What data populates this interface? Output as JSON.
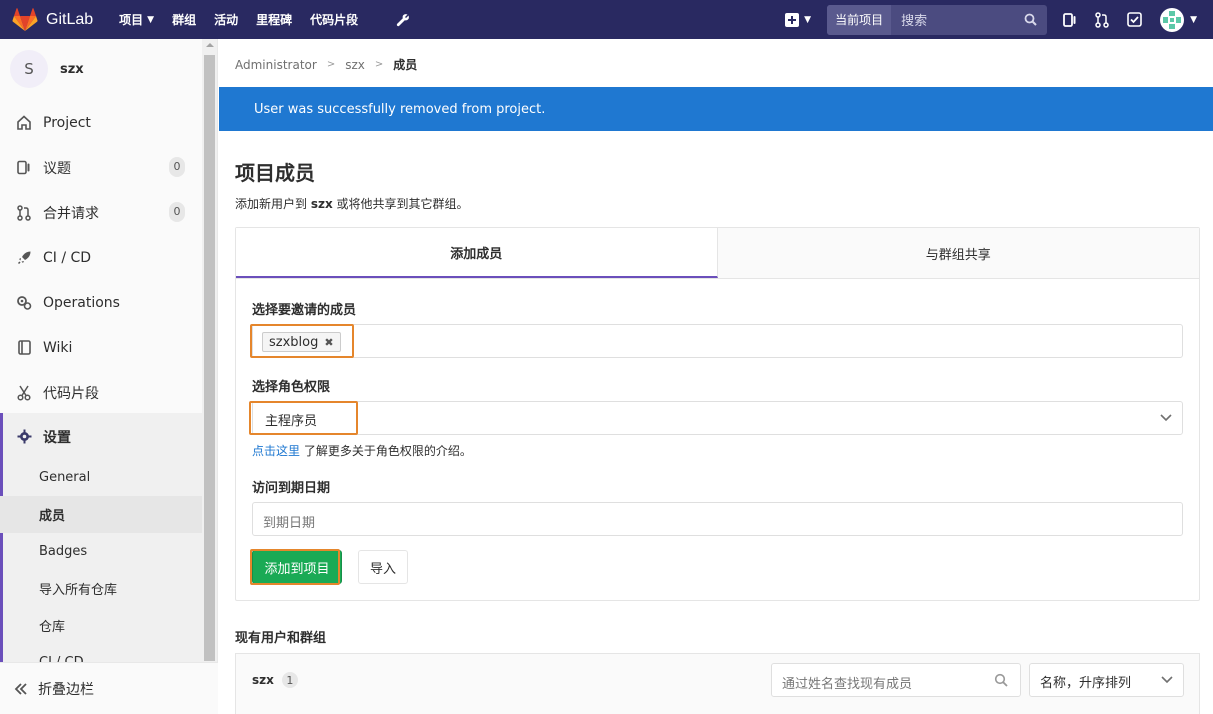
{
  "navbar": {
    "brand": "GitLab",
    "items": [
      "项目",
      "群组",
      "活动",
      "里程碑",
      "代码片段"
    ],
    "search_scope": "当前项目",
    "search_placeholder": "搜索",
    "bg_color": "#292961"
  },
  "sidebar": {
    "project_initial": "S",
    "project_name": "szx",
    "items": [
      {
        "label": "Project",
        "icon": "home-icon"
      },
      {
        "label": "议题",
        "icon": "issues-icon",
        "badge": "0"
      },
      {
        "label": "合并请求",
        "icon": "merge-request-icon",
        "badge": "0"
      },
      {
        "label": "CI / CD",
        "icon": "rocket-icon"
      },
      {
        "label": "Operations",
        "icon": "cloud-gear-icon"
      },
      {
        "label": "Wiki",
        "icon": "book-icon"
      },
      {
        "label": "代码片段",
        "icon": "scissors-icon"
      },
      {
        "label": "设置",
        "icon": "settings-gear-icon"
      }
    ],
    "settings_sub": [
      "General",
      "成员",
      "Badges",
      "导入所有仓库",
      "仓库",
      "CI / CD"
    ],
    "collapse_label": "折叠边栏"
  },
  "breadcrumb": [
    "Administrator",
    "szx",
    "成员"
  ],
  "flash": {
    "message": "User was successfully removed from project.",
    "color": "#1f78d1"
  },
  "page": {
    "title": "项目成员",
    "desc_prefix": "添加新用户到 ",
    "desc_project": "szx",
    "desc_suffix": " 或将他共享到其它群组。"
  },
  "tabs": [
    "添加成员",
    "与群组共享"
  ],
  "form": {
    "invite_label": "选择要邀请的成员",
    "invite_token": "szxblog",
    "role_label": "选择角色权限",
    "role_value": "主程序员",
    "help_link": "点击这里",
    "help_text": " 了解更多关于角色权限的介绍。",
    "expires_label": "访问到期日期",
    "expires_placeholder": "到期日期",
    "submit_label": "添加到项目",
    "import_label": "导入"
  },
  "members": {
    "section_title": "现有用户和群组",
    "group_name": "szx",
    "count": "1",
    "search_placeholder": "通过姓名查找现有成员",
    "sort_value": "名称，升序排列"
  }
}
